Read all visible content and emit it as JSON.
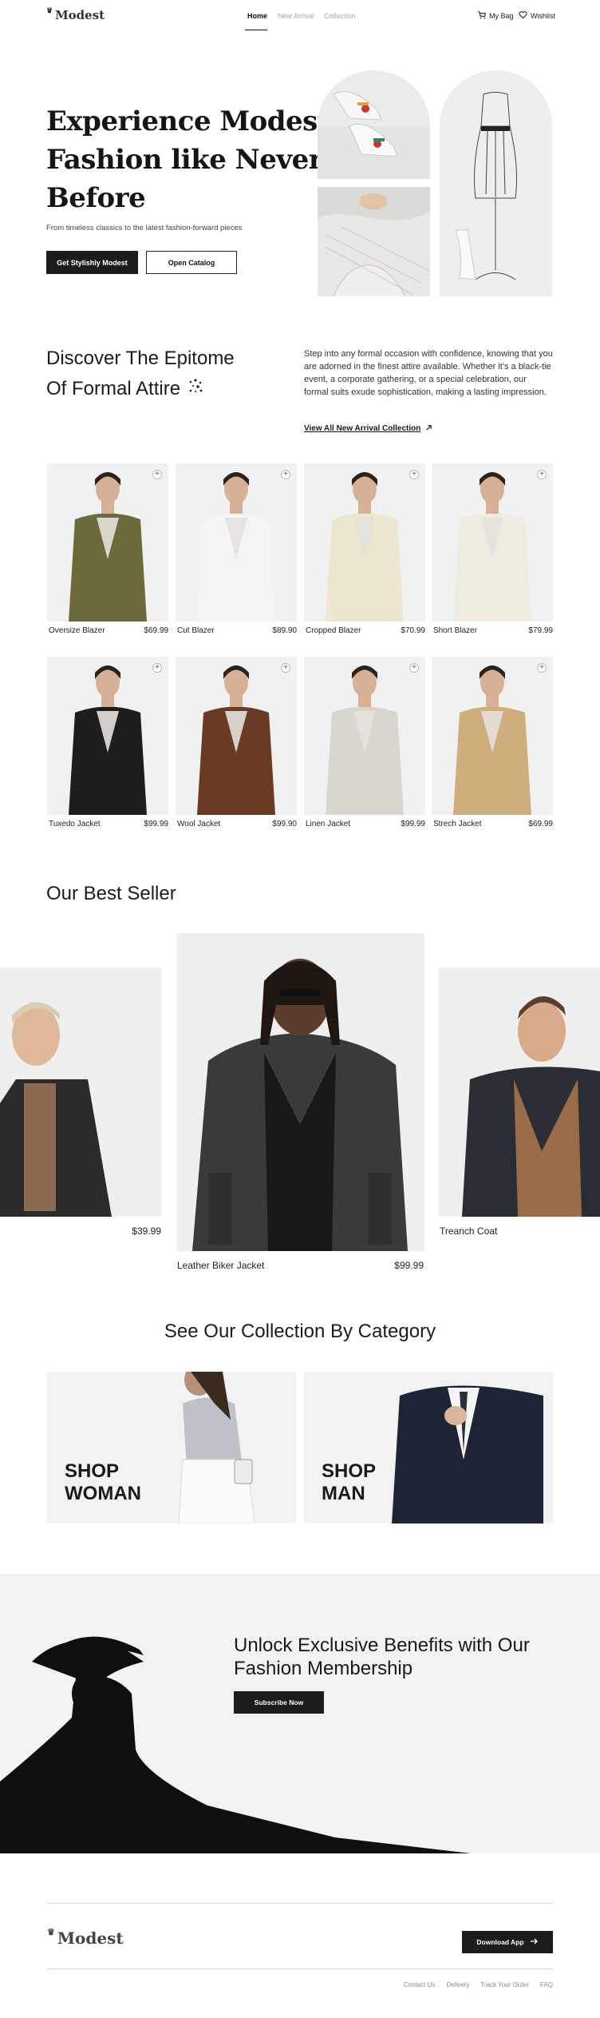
{
  "brand": {
    "name": "Modest"
  },
  "nav": {
    "links": [
      "Home",
      "New Arrival",
      "Collection"
    ],
    "bag_label": "My Bag",
    "wishlist_label": "Wishlist"
  },
  "hero": {
    "title_line1": "Experience Modest",
    "title_line2": "Fashion like Never",
    "title_line3": "Before",
    "subtitle": "From timeless classics to the latest fashion-forward pieces",
    "primary_button": "Get Stylishly Modest",
    "secondary_button": "Open Catalog"
  },
  "discover": {
    "title_line1": "Discover The Epitome",
    "title_line2": "Of Formal Attire",
    "description": "Step into any formal occasion with confidence, knowing that you are adorned in the finest attire available. Whether it's a black-tie event, a corporate gathering, or a special celebration, our formal suits exude sophistication, making a lasting impression.",
    "link": "View All New Arrival Collection"
  },
  "products": [
    {
      "name": "Oversize Blazer",
      "price": "$69.99",
      "color": "#6b6a3a"
    },
    {
      "name": "Cut Blazer",
      "price": "$89.90",
      "color": "#f4f4f2"
    },
    {
      "name": "Cropped Blazer",
      "price": "$70.99",
      "color": "#ece7cf"
    },
    {
      "name": "Short Blazer",
      "price": "$79.99",
      "color": "#efebe0"
    },
    {
      "name": "Tuxedo Jacket",
      "price": "$99.99",
      "color": "#1d1d1d"
    },
    {
      "name": "Wool Jacket",
      "price": "$99.90",
      "color": "#6b3a22"
    },
    {
      "name": "Linen Jacket",
      "price": "$99.99",
      "color": "#d8d6cf"
    },
    {
      "name": "Strech Jacket",
      "price": "$69.99",
      "color": "#cfae7e"
    }
  ],
  "bestseller": {
    "title": "Our Best Seller",
    "left_price": "$39.99",
    "center_name": "Leather Biker Jacket",
    "center_price": "$99.99",
    "right_name": "Treanch Coat"
  },
  "category": {
    "title": "See Our Collection By Category",
    "woman_line1": "SHOP",
    "woman_line2": "WOMAN",
    "man_line1": "SHOP",
    "man_line2": "MAN"
  },
  "membership": {
    "title_line1": "Unlock Exclusive Benefits with Our",
    "title_line2": "Fashion Membership",
    "button": "Subscribe Now"
  },
  "footer": {
    "app_button": "Download App",
    "links": [
      "Contact Us",
      "Delivery",
      "Track Your Order",
      "FAQ"
    ]
  }
}
